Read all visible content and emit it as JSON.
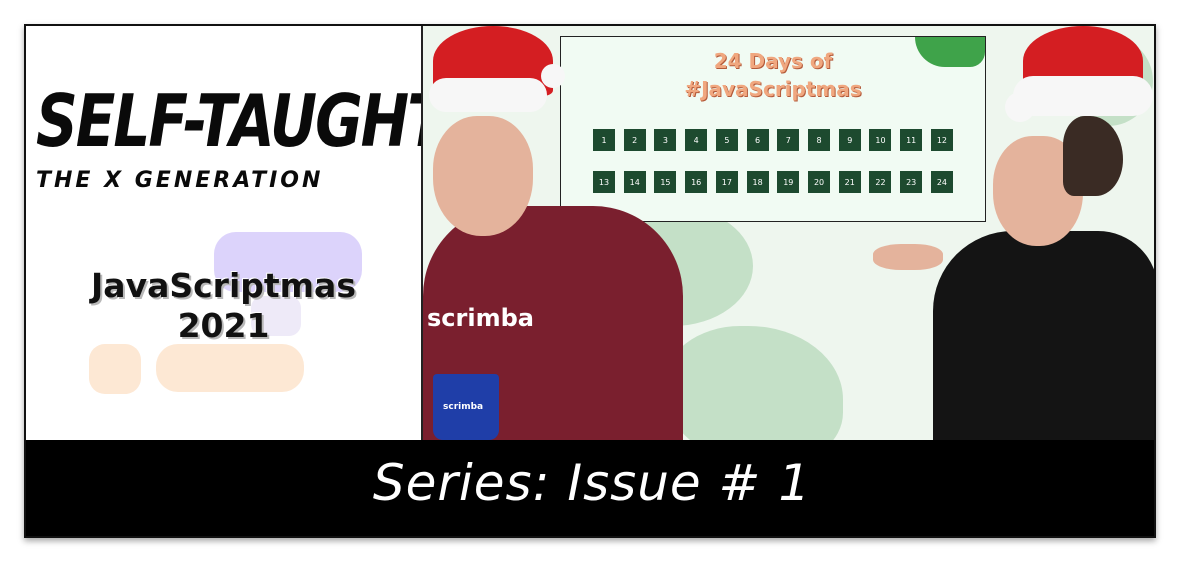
{
  "left_panel": {
    "headline": "SELF-TAUGHT",
    "subheadline": "THE X GENERATION",
    "topic_line1": "JavaScriptmas",
    "topic_line2": "2021"
  },
  "calendar": {
    "title_line1": "24 Days of",
    "title_line2": "#JavaScriptmas",
    "row1": [
      "1",
      "2",
      "3",
      "4",
      "5",
      "6",
      "7",
      "8",
      "9",
      "10",
      "11",
      "12"
    ],
    "row2": [
      "13",
      "14",
      "15",
      "16",
      "17",
      "18",
      "19",
      "20",
      "21",
      "22",
      "23",
      "24"
    ]
  },
  "photo": {
    "hoodie_text": "scrimba",
    "mug_text": "scrimba"
  },
  "footer": {
    "series_label": "Series: Issue # 1"
  },
  "colors": {
    "calendar_title": "#f0a77f",
    "day_tile": "#1d4a2f",
    "hoodie": "#7a1f2e",
    "footer_bg": "#000000"
  }
}
